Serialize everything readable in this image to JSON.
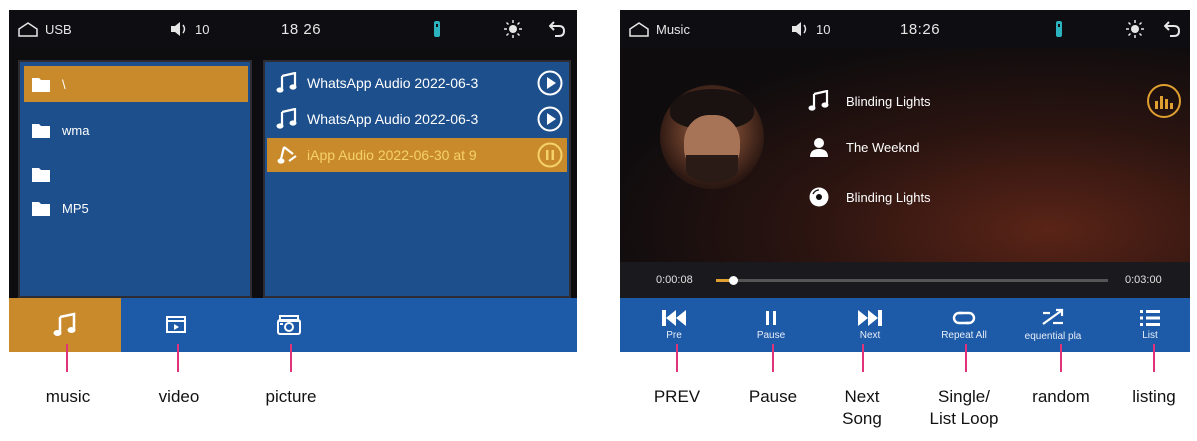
{
  "colors": {
    "accent_orange": "#c98a2c",
    "bar_blue": "#1d5aa8",
    "panel_blue": "#1c4f8c",
    "callout_pink": "#e0337a"
  },
  "left_screen": {
    "status": {
      "home_icon": "home-icon",
      "source": "USB",
      "volume": "10",
      "time": "18 26"
    },
    "folders": [
      {
        "name": "\\",
        "selected": true
      },
      {
        "name": "wma",
        "selected": false
      },
      {
        "name": "",
        "selected": false
      },
      {
        "name": "MP5",
        "selected": false
      }
    ],
    "files": [
      {
        "name": "WhatsApp Audio 2022-06-3",
        "state": "play"
      },
      {
        "name": "WhatsApp Audio 2022-06-3",
        "state": "play"
      },
      {
        "name": "iApp Audio 2022-06-30 at 9",
        "state": "playing"
      }
    ],
    "tabs": [
      {
        "icon": "music-note-icon",
        "active": true
      },
      {
        "icon": "video-icon",
        "active": false
      },
      {
        "icon": "picture-icon",
        "active": false
      }
    ]
  },
  "right_screen": {
    "status": {
      "home_icon": "home-icon",
      "source": "Music",
      "volume": "10",
      "time": "18:26"
    },
    "track": {
      "title": "Blinding Lights",
      "artist": "The Weeknd",
      "album": "Blinding Lights"
    },
    "progress": {
      "elapsed": "0:00:08",
      "total": "0:03:00",
      "fraction": 0.044
    },
    "controls": [
      {
        "icon": "previous-icon",
        "label": "Pre"
      },
      {
        "icon": "pause-icon",
        "label": "Pause"
      },
      {
        "icon": "next-icon",
        "label": "Next"
      },
      {
        "icon": "repeat-icon",
        "label": "Repeat All"
      },
      {
        "icon": "shuffle-icon",
        "label": "equential pla"
      },
      {
        "icon": "list-icon",
        "label": "List"
      }
    ]
  },
  "captions": {
    "music": "music",
    "video": "video",
    "picture": "picture",
    "prev": "PREV",
    "pause": "Pause",
    "next_line1": "Next",
    "next_line2": "Song",
    "loop_line1": "Single/",
    "loop_line2": "List Loop",
    "random": "random",
    "listing": "listing"
  }
}
